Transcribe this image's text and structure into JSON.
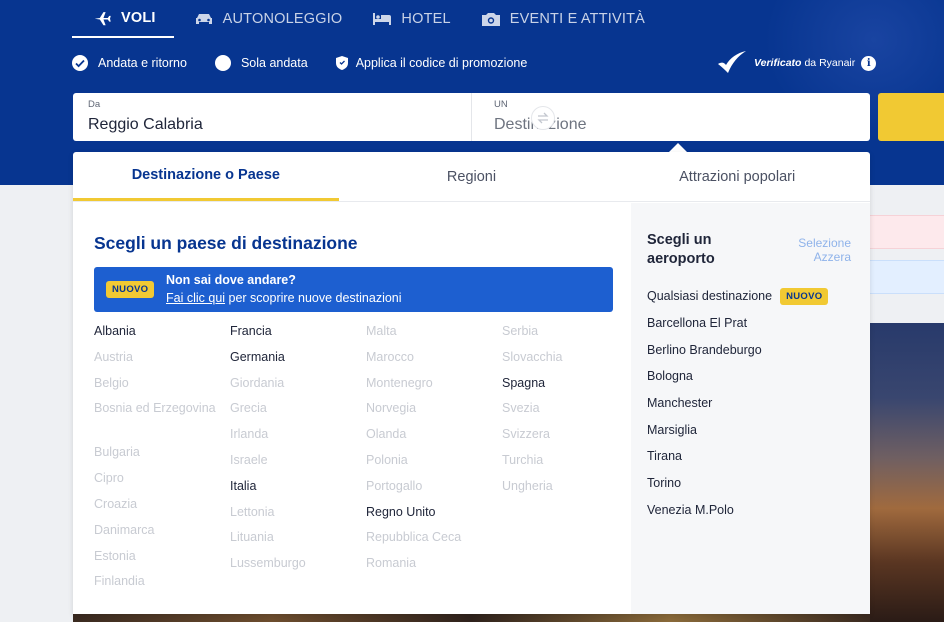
{
  "nav": {
    "tabs": [
      {
        "label": "VOLI",
        "icon": "plane-icon"
      },
      {
        "label": "AUTONOLEGGIO",
        "icon": "car-icon"
      },
      {
        "label": "HOTEL",
        "icon": "bed-icon"
      },
      {
        "label": "EVENTI E ATTIVITÀ",
        "icon": "camera-icon"
      }
    ]
  },
  "trip_options": {
    "round_trip": "Andata e ritorno",
    "one_way": "Sola andata",
    "promo_code": "Applica il codice di promozione",
    "verified_bold": "Verificato",
    "verified_rest": "da Ryanair"
  },
  "search": {
    "from_label": "Da",
    "from_value": "Reggio Calabria",
    "to_label": "UN",
    "to_placeholder": "Destinazione"
  },
  "dropdown": {
    "tabs": [
      "Destinazione o Paese",
      "Regioni",
      "Attrazioni popolari"
    ],
    "title": "Scegli un paese di destinazione",
    "promo": {
      "badge": "NUOVO",
      "line1": "Non sai dove andare?",
      "link": "Fai clic qui",
      "line2_rest": " per scoprire nuove destinazioni"
    },
    "countries": [
      [
        {
          "name": "Albania",
          "on": true
        },
        {
          "name": "Austria",
          "on": false
        },
        {
          "name": "Belgio",
          "on": false
        },
        {
          "name": "Bosnia ed Erzegovina",
          "on": false
        },
        {
          "name": "Bulgaria",
          "on": false
        },
        {
          "name": "Cipro",
          "on": false
        },
        {
          "name": "Croazia",
          "on": false
        },
        {
          "name": "Danimarca",
          "on": false
        },
        {
          "name": "Estonia",
          "on": false
        },
        {
          "name": "Finlandia",
          "on": false
        }
      ],
      [
        {
          "name": "Francia",
          "on": true
        },
        {
          "name": "Germania",
          "on": true
        },
        {
          "name": "Giordania",
          "on": false
        },
        {
          "name": "Grecia",
          "on": false
        },
        {
          "name": "Irlanda",
          "on": false
        },
        {
          "name": "Israele",
          "on": false
        },
        {
          "name": "Italia",
          "on": true
        },
        {
          "name": "Lettonia",
          "on": false
        },
        {
          "name": "Lituania",
          "on": false
        },
        {
          "name": "Lussemburgo",
          "on": false
        }
      ],
      [
        {
          "name": "Malta",
          "on": false
        },
        {
          "name": "Marocco",
          "on": false
        },
        {
          "name": "Montenegro",
          "on": false
        },
        {
          "name": "Norvegia",
          "on": false
        },
        {
          "name": "Olanda",
          "on": false
        },
        {
          "name": "Polonia",
          "on": false
        },
        {
          "name": "Portogallo",
          "on": false
        },
        {
          "name": "Regno Unito",
          "on": true
        },
        {
          "name": "Repubblica Ceca",
          "on": false
        },
        {
          "name": "Romania",
          "on": false
        }
      ],
      [
        {
          "name": "Serbia",
          "on": false
        },
        {
          "name": "Slovacchia",
          "on": false
        },
        {
          "name": "Spagna",
          "on": true
        },
        {
          "name": "Svezia",
          "on": false
        },
        {
          "name": "Svizzera",
          "on": false
        },
        {
          "name": "Turchia",
          "on": false
        },
        {
          "name": "Ungheria",
          "on": false
        }
      ]
    ],
    "airport_title": "Scegli un aeroporto",
    "select_label": "Selezione",
    "reset_label": "Azzera",
    "airports": [
      {
        "name": "Qualsiasi destinazione",
        "badge": "NUOVO"
      },
      {
        "name": "Barcellona El Prat"
      },
      {
        "name": "Berlino Brandeburgo"
      },
      {
        "name": "Bologna"
      },
      {
        "name": "Manchester"
      },
      {
        "name": "Marsiglia"
      },
      {
        "name": "Tirana"
      },
      {
        "name": "Torino"
      },
      {
        "name": "Venezia M.Polo"
      }
    ]
  },
  "colors": {
    "brand_blue": "#073590",
    "accent_yellow": "#f1c933",
    "promo_blue": "#1d5fd0"
  }
}
